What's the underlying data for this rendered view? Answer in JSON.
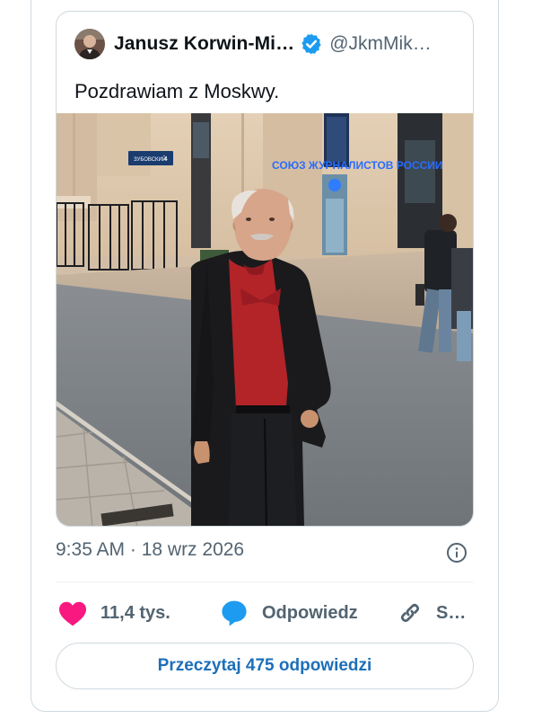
{
  "tweet": {
    "author_name": "Janusz Korwin-Mi…",
    "author_handle": "@JkmMik…",
    "text": "Pozdrawiam z Moskwy.",
    "timestamp": "9:35 AM · 18 wrz 2026"
  },
  "photo": {
    "sign_building": "СОЮЗ ЖУРНАЛИСТОВ РОССИИ",
    "sign_street": "ЗУБОВСКИЙ",
    "sign_number": "4"
  },
  "actions": {
    "like_count": "11,4 tys.",
    "reply_label": "Odpowiedz",
    "share_label": "S…"
  },
  "read_replies_label": "Przeczytaj 475 odpowiedzi",
  "icons": {
    "verified": "verified-badge-icon",
    "info": "info-icon",
    "like": "heart-icon",
    "reply": "speech-bubble-icon",
    "share": "link-icon"
  },
  "colors": {
    "verified_blue": "#1d9bf0",
    "like_pink": "#f91880",
    "reply_blue": "#1d9bf0",
    "link_text_blue": "#1d6fb8",
    "muted_text": "#536471",
    "border": "#cfd9de"
  }
}
